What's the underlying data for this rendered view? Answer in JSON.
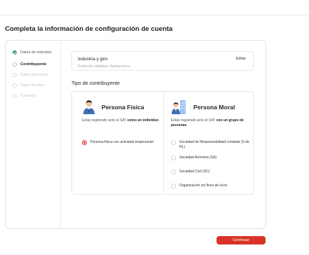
{
  "page_title": "Completa la información de configuración de cuenta",
  "steps": [
    {
      "label": "Datos de industria",
      "state": "done"
    },
    {
      "label": "Contribuyente",
      "state": "active"
    },
    {
      "label": "Datos bancarios",
      "state": "pending"
    },
    {
      "label": "Datos fiscales",
      "state": "pending"
    },
    {
      "label": "Contacto",
      "state": "pending"
    }
  ],
  "industry": {
    "title": "Industria y giro",
    "subtitle": "Productos digitales  •  Aplicaciones",
    "edit_label": "Editar"
  },
  "tipo_title": "Tipo de contribuyente",
  "fisica": {
    "title": "Persona Física",
    "desc_pre": "Estás registrado ante el SAT ",
    "desc_bold": "como un individuo",
    "options": [
      "Persona física con actividad empresarial"
    ]
  },
  "moral": {
    "title": "Persona Moral",
    "desc_pre": "Estás registrado ante el SAT ",
    "desc_bold": "con un grupo de personas",
    "options": [
      "Sociedad de Responsabilidad Limitada (S de RL)",
      "Sociedad Anónima (SA)",
      "Sociedad Civil (SC)",
      "Organización sin fines de lucro"
    ]
  },
  "continue_label": "Continuar",
  "colors": {
    "accent": "#d93327",
    "success": "#2fa36b"
  }
}
